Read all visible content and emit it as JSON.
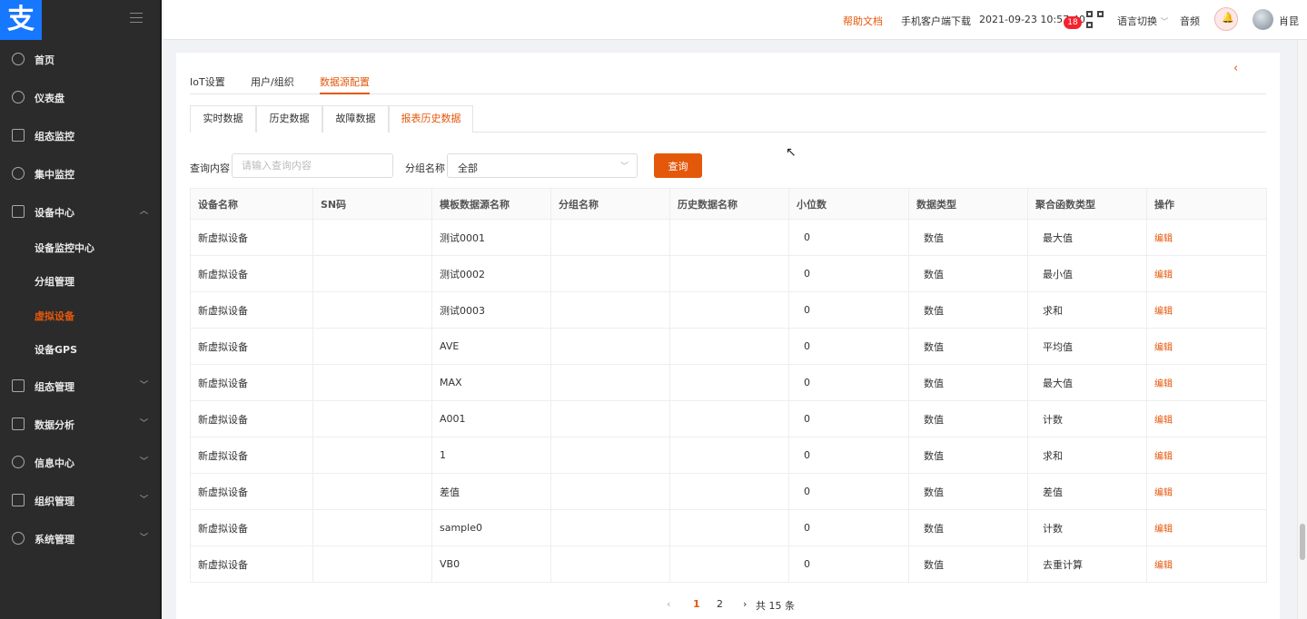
{
  "sidebar": {
    "logo_text": "支",
    "items": [
      {
        "label": "首页",
        "icon": "user-icon"
      },
      {
        "label": "仪表盘",
        "icon": "dashboard-icon"
      },
      {
        "label": "组态监控",
        "icon": "monitor-icon"
      },
      {
        "label": "集中监控",
        "icon": "location-icon"
      },
      {
        "label": "设备中心",
        "icon": "device-icon"
      },
      {
        "label": "组态管理",
        "icon": "config-icon"
      },
      {
        "label": "数据分析",
        "icon": "analysis-icon"
      },
      {
        "label": "信息中心",
        "icon": "message-icon"
      },
      {
        "label": "组织管理",
        "icon": "org-icon"
      },
      {
        "label": "系统管理",
        "icon": "settings-icon"
      }
    ],
    "sub_items": [
      "设备监控中心",
      "分组管理",
      "虚拟设备",
      "设备GPS"
    ]
  },
  "topbar": {
    "help": "帮助文档",
    "client_download": "手机客户端下载",
    "datetime": "2021-09-23 10:57:40",
    "language": "语言切换",
    "audio": "音频",
    "badge_count": "18",
    "username": "肖昆"
  },
  "tabs_main": [
    "IoT设置",
    "用户/组织",
    "数据源配置"
  ],
  "tabs_sub": [
    "实时数据",
    "历史数据",
    "故障数据",
    "报表历史数据"
  ],
  "filter": {
    "query_label": "查询内容",
    "query_placeholder": "请输入查询内容",
    "group_label": "分组名称",
    "group_value": "全部",
    "search_button": "查询"
  },
  "table": {
    "headers": [
      "设备名称",
      "SN码",
      "模板数据源名称",
      "分组名称",
      "历史数据名称",
      "小位数",
      "数据类型",
      "聚合函数类型",
      "操作"
    ],
    "rows": [
      [
        "新虚拟设备",
        "",
        "测试0001",
        "",
        "",
        "0",
        "数值",
        "最大值",
        "编辑"
      ],
      [
        "新虚拟设备",
        "",
        "测试0002",
        "",
        "",
        "0",
        "数值",
        "最小值",
        "编辑"
      ],
      [
        "新虚拟设备",
        "",
        "测试0003",
        "",
        "",
        "0",
        "数值",
        "求和",
        "编辑"
      ],
      [
        "新虚拟设备",
        "",
        "AVE",
        "",
        "",
        "0",
        "数值",
        "平均值",
        "编辑"
      ],
      [
        "新虚拟设备",
        "",
        "MAX",
        "",
        "",
        "0",
        "数值",
        "最大值",
        "编辑"
      ],
      [
        "新虚拟设备",
        "",
        "A001",
        "",
        "",
        "0",
        "数值",
        "计数",
        "编辑"
      ],
      [
        "新虚拟设备",
        "",
        "1",
        "",
        "",
        "0",
        "数值",
        "求和",
        "编辑"
      ],
      [
        "新虚拟设备",
        "",
        "差值",
        "",
        "",
        "0",
        "数值",
        "差值",
        "编辑"
      ],
      [
        "新虚拟设备",
        "",
        "sample0",
        "",
        "",
        "0",
        "数值",
        "计数",
        "编辑"
      ],
      [
        "新虚拟设备",
        "",
        "VB0",
        "",
        "",
        "0",
        "数值",
        "去重计算",
        "编辑"
      ]
    ]
  },
  "pagination": {
    "prev": "‹",
    "pages": [
      "1",
      "2"
    ],
    "next": "›",
    "total": "共 15 条"
  },
  "colors": {
    "accent": "#e4580c",
    "sidebar_bg": "#2b2b2b",
    "logo_bg": "#1677ff"
  }
}
